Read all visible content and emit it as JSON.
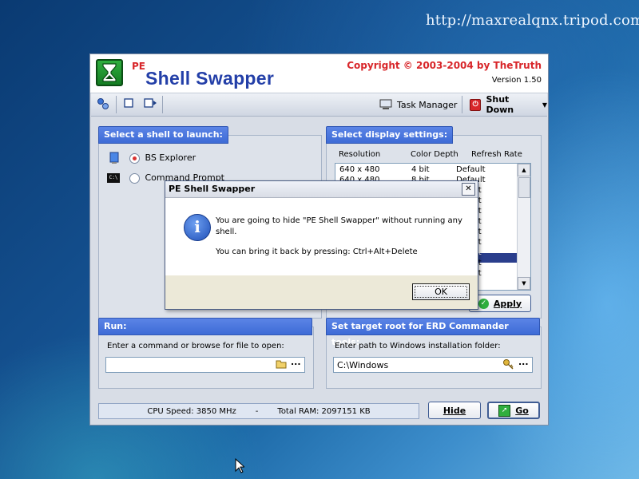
{
  "desktop": {
    "url": "http://maxrealqnx.tripod.com"
  },
  "app": {
    "pe_label": "PE",
    "title": "Shell Swapper",
    "copyright": "Copyright © 2003-2004 by TheTruth",
    "version": "Version 1.50"
  },
  "toolbar": {
    "task_manager_label": "Task Manager",
    "shutdown_label": "Shut Down"
  },
  "shells": {
    "header": "Select a shell to launch:",
    "items": [
      {
        "label": "BS Explorer",
        "selected": true
      },
      {
        "label": "Command Prompt",
        "selected": false
      }
    ]
  },
  "display": {
    "header": "Select display settings:",
    "columns": [
      "Resolution",
      "Color Depth",
      "Refresh Rate"
    ],
    "rows": [
      {
        "res": "640 x 480",
        "depth": "4 bit",
        "rate": "Default"
      },
      {
        "res": "640 x 480",
        "depth": "8 bit",
        "rate": "Default"
      }
    ],
    "visible_rate_fragments": [
      "lt",
      "lt",
      "lt",
      "lt",
      "lt",
      "lt",
      "lt",
      "lt",
      "lt"
    ],
    "apply_label": "Apply"
  },
  "run": {
    "header": "Run:",
    "prompt": "Enter a command or browse for file to open:",
    "value": "",
    "browse_label": "..."
  },
  "erd": {
    "header": "Set target root for ERD Commander tools:",
    "prompt": "Enter path to Windows installation folder:",
    "value": "C:\\Windows",
    "browse_label": "..."
  },
  "status": {
    "cpu": "CPU Speed: 3850 MHz",
    "sep": "-",
    "ram": "Total RAM: 2097151 KB"
  },
  "buttons": {
    "hide": "Hide",
    "go": "Go"
  },
  "dialog": {
    "title": "PE Shell Swapper",
    "close": "✕",
    "line1": "You are going to hide \"PE Shell Swapper\" without running any",
    "line2": "shell.",
    "line3": "You can bring it back by pressing: Ctrl+Alt+Delete",
    "ok": "OK"
  },
  "colors": {
    "accent_blue": "#3d6bd6",
    "title_blue": "#233fa8",
    "red": "#d8262a"
  }
}
